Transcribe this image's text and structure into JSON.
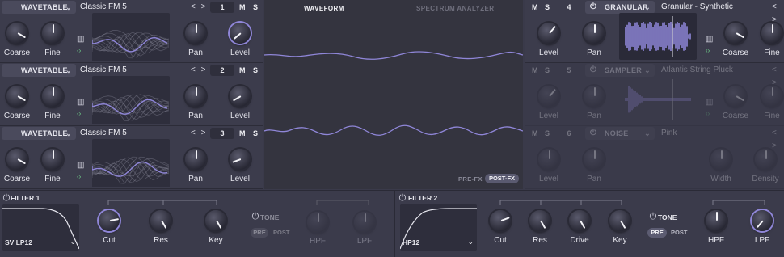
{
  "oscillators": [
    {
      "type": "WAVETABLE",
      "preset": "Classic FM 5",
      "number": "1",
      "mute": "M",
      "solo": "S",
      "knobs": [
        "Coarse",
        "Fine",
        "Pan",
        "Level"
      ]
    },
    {
      "type": "WAVETABLE",
      "preset": "Classic FM 5",
      "number": "2",
      "mute": "M",
      "solo": "S",
      "knobs": [
        "Coarse",
        "Fine",
        "Pan",
        "Level"
      ]
    },
    {
      "type": "WAVETABLE",
      "preset": "Classic FM 5",
      "number": "3",
      "mute": "M",
      "solo": "S",
      "knobs": [
        "Coarse",
        "Fine",
        "Pan",
        "Level"
      ]
    }
  ],
  "arrows": "< >",
  "viewer": {
    "tab_waveform": "WAVEFORM",
    "tab_spectrum": "SPECTRUM ANALYZER",
    "pre_fx": "PRE-FX",
    "post_fx": "POST-FX"
  },
  "right_slots": [
    {
      "mute": "M",
      "solo": "S",
      "number": "4",
      "type": "GRANULAR",
      "preset": "Granular - Synthetic",
      "knobs": [
        "Level",
        "Pan",
        "Coarse",
        "Fine"
      ]
    },
    {
      "mute": "M",
      "solo": "S",
      "number": "5",
      "type": "SAMPLER",
      "preset": "Atlantis String Pluck",
      "knobs": [
        "Level",
        "Pan",
        "Coarse",
        "Fine"
      ]
    },
    {
      "mute": "M",
      "solo": "S",
      "number": "6",
      "type": "NOISE",
      "preset": "Pink",
      "knobs": [
        "Level",
        "Pan",
        "Width",
        "Density"
      ]
    }
  ],
  "filter1": {
    "title": "FILTER 1",
    "type": "SV LP12",
    "knobs": [
      "Cut",
      "Res",
      "Key"
    ],
    "tone": "TONE",
    "pre": "PRE",
    "post": "POST",
    "hpf": "HPF",
    "lpf": "LPF"
  },
  "filter2": {
    "title": "FILTER 2",
    "type": "HP12",
    "knobs": [
      "Cut",
      "Res",
      "Drive",
      "Key"
    ],
    "tone": "TONE",
    "pre": "PRE",
    "post": "POST",
    "hpf": "HPF",
    "lpf": "LPF"
  },
  "colors": {
    "accent": "#8f86d8",
    "panel": "#3c3c4c",
    "dark": "#2e2e3c",
    "green": "#6fd08a"
  }
}
